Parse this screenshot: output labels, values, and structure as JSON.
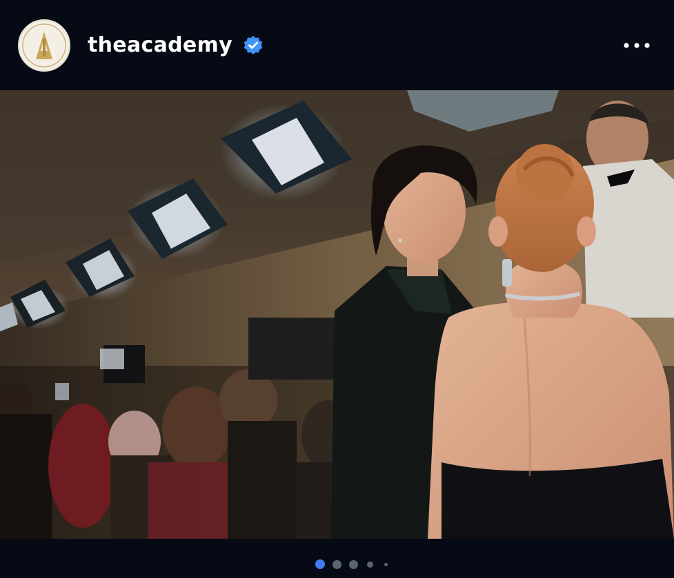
{
  "post": {
    "username": "theacademy",
    "verified": true,
    "avatar_icon": "oscar-statuette-logo-icon",
    "more_icon": "more-horizontal-icon"
  },
  "photo": {
    "subject": "red-carpet-photo"
  },
  "carousel": {
    "total_dots": 5,
    "active_index": 0,
    "active_color": "#3f7bf5",
    "inactive_color": "#5b6270"
  },
  "colors": {
    "background": "#060a14",
    "verified_badge": "#3f95f5",
    "username": "#ffffff"
  }
}
